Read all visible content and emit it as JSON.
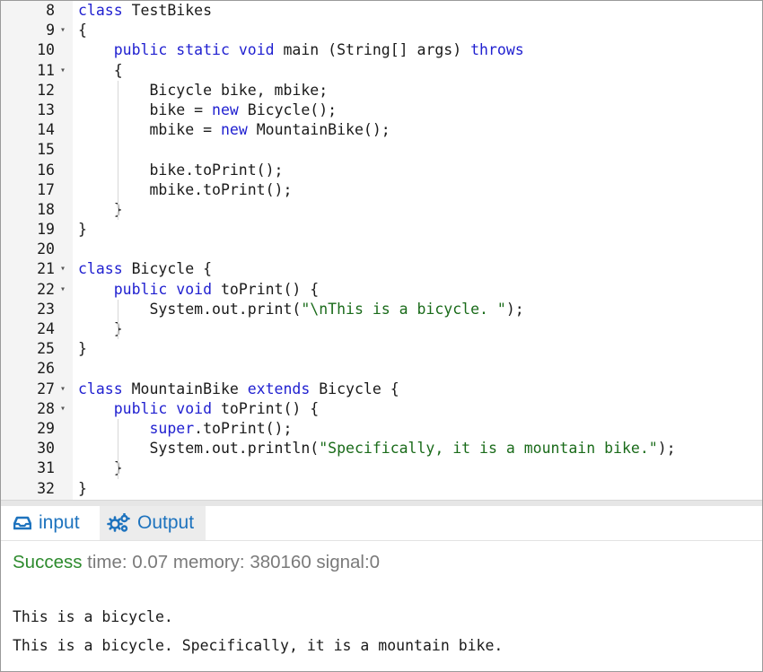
{
  "editor": {
    "lines": [
      {
        "num": "8",
        "fold": false,
        "segments": [
          {
            "t": "kw",
            "v": "class"
          },
          {
            "t": "p",
            "v": " TestBikes"
          }
        ]
      },
      {
        "num": "9",
        "fold": true,
        "segments": [
          {
            "t": "p",
            "v": "{"
          }
        ]
      },
      {
        "num": "10",
        "fold": false,
        "segments": [
          {
            "t": "p",
            "v": "    "
          },
          {
            "t": "kw",
            "v": "public static void"
          },
          {
            "t": "p",
            "v": " main (String[] args) "
          },
          {
            "t": "kw",
            "v": "throws"
          }
        ]
      },
      {
        "num": "11",
        "fold": true,
        "segments": [
          {
            "t": "p",
            "v": "    {"
          }
        ]
      },
      {
        "num": "12",
        "fold": false,
        "segments": [
          {
            "t": "p",
            "v": "        Bicycle bike, mbike;"
          }
        ]
      },
      {
        "num": "13",
        "fold": false,
        "segments": [
          {
            "t": "p",
            "v": "        bike = "
          },
          {
            "t": "kw",
            "v": "new"
          },
          {
            "t": "p",
            "v": " Bicycle();"
          }
        ]
      },
      {
        "num": "14",
        "fold": false,
        "segments": [
          {
            "t": "p",
            "v": "        mbike = "
          },
          {
            "t": "kw",
            "v": "new"
          },
          {
            "t": "p",
            "v": " MountainBike();"
          }
        ]
      },
      {
        "num": "15",
        "fold": false,
        "segments": []
      },
      {
        "num": "16",
        "fold": false,
        "segments": [
          {
            "t": "p",
            "v": "        bike.toPrint();"
          }
        ]
      },
      {
        "num": "17",
        "fold": false,
        "segments": [
          {
            "t": "p",
            "v": "        mbike.toPrint();"
          }
        ]
      },
      {
        "num": "18",
        "fold": false,
        "segments": [
          {
            "t": "p",
            "v": "    }"
          }
        ]
      },
      {
        "num": "19",
        "fold": false,
        "segments": [
          {
            "t": "p",
            "v": "}"
          }
        ]
      },
      {
        "num": "20",
        "fold": false,
        "segments": []
      },
      {
        "num": "21",
        "fold": true,
        "segments": [
          {
            "t": "kw",
            "v": "class"
          },
          {
            "t": "p",
            "v": " Bicycle {"
          }
        ]
      },
      {
        "num": "22",
        "fold": true,
        "segments": [
          {
            "t": "p",
            "v": "    "
          },
          {
            "t": "kw",
            "v": "public void"
          },
          {
            "t": "p",
            "v": " toPrint() {"
          }
        ]
      },
      {
        "num": "23",
        "fold": false,
        "segments": [
          {
            "t": "p",
            "v": "        System.out.print("
          },
          {
            "t": "str",
            "v": "\"\\nThis is a bicycle. \""
          },
          {
            "t": "p",
            "v": ");"
          }
        ]
      },
      {
        "num": "24",
        "fold": false,
        "segments": [
          {
            "t": "p",
            "v": "    }"
          }
        ]
      },
      {
        "num": "25",
        "fold": false,
        "segments": [
          {
            "t": "p",
            "v": "}"
          }
        ]
      },
      {
        "num": "26",
        "fold": false,
        "segments": []
      },
      {
        "num": "27",
        "fold": true,
        "segments": [
          {
            "t": "kw",
            "v": "class"
          },
          {
            "t": "p",
            "v": " MountainBike "
          },
          {
            "t": "kw",
            "v": "extends"
          },
          {
            "t": "p",
            "v": " Bicycle {"
          }
        ]
      },
      {
        "num": "28",
        "fold": true,
        "segments": [
          {
            "t": "p",
            "v": "    "
          },
          {
            "t": "kw",
            "v": "public void"
          },
          {
            "t": "p",
            "v": " toPrint() {"
          }
        ]
      },
      {
        "num": "29",
        "fold": false,
        "segments": [
          {
            "t": "p",
            "v": "        "
          },
          {
            "t": "kw",
            "v": "super"
          },
          {
            "t": "p",
            "v": ".toPrint();"
          }
        ]
      },
      {
        "num": "30",
        "fold": false,
        "segments": [
          {
            "t": "p",
            "v": "        System.out.println("
          },
          {
            "t": "str",
            "v": "\"Specifically, it is a mountain bike.\""
          },
          {
            "t": "p",
            "v": ");"
          }
        ]
      },
      {
        "num": "31",
        "fold": false,
        "segments": [
          {
            "t": "p",
            "v": "    }"
          }
        ]
      },
      {
        "num": "32",
        "fold": false,
        "segments": [
          {
            "t": "p",
            "v": "}"
          }
        ]
      }
    ]
  },
  "tabs": {
    "input_label": "input",
    "output_label": "Output",
    "input_icon": "inbox-icon",
    "output_icon": "gears-icon"
  },
  "status": {
    "result": "Success",
    "details": " time: 0.07 memory: 380160 signal:0"
  },
  "output": {
    "line1": "This is a bicycle.",
    "line2": "This is a bicycle. Specifically, it is a mountain bike."
  },
  "colors": {
    "keyword": "#1f1fd0",
    "string": "#1a6b1a",
    "success": "#2e8b2e",
    "tab_text": "#1e73be"
  }
}
